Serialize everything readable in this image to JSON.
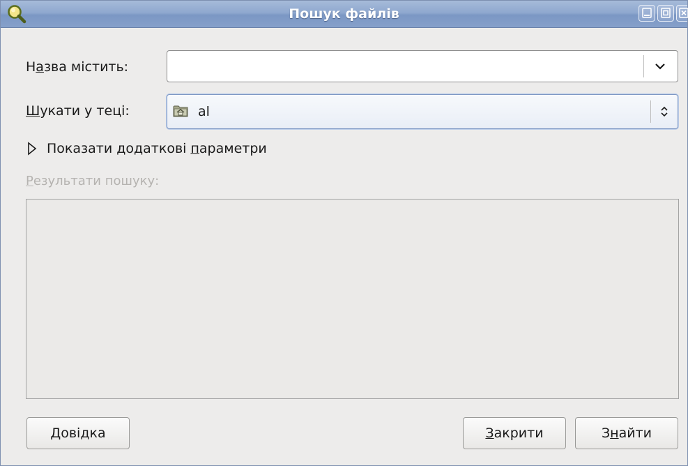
{
  "window": {
    "title": "Пошук файлів",
    "app_icon": "magnifier-icon",
    "controls": [
      "minimize-icon",
      "maximize-icon",
      "close-icon"
    ]
  },
  "name_row": {
    "label_pre": "Н",
    "label_mnemonic": "а",
    "label_post": "зва містить:",
    "value": ""
  },
  "folder_row": {
    "label_mnemonic": "Ш",
    "label_post": "укати у теці:",
    "value": "al",
    "icon": "home-folder-icon"
  },
  "expander": {
    "label_pre": "Показати додаткові ",
    "label_mnemonic": "п",
    "label_post": "араметри",
    "icon": "triangle-right-icon"
  },
  "results": {
    "label_mnemonic": "Р",
    "label_post": "езультати пошуку:"
  },
  "buttons": {
    "help_mnemonic": "Д",
    "help_post": "овідка",
    "close_mnemonic": "З",
    "close_post": "акрити",
    "find_pre": "З",
    "find_mnemonic": "н",
    "find_post": "айти"
  },
  "colors": {
    "titlebar": "#8fa8cf",
    "window_bg": "#edeceb",
    "focus_border": "#7e98c4",
    "disabled_text": "#b5b3b0"
  }
}
